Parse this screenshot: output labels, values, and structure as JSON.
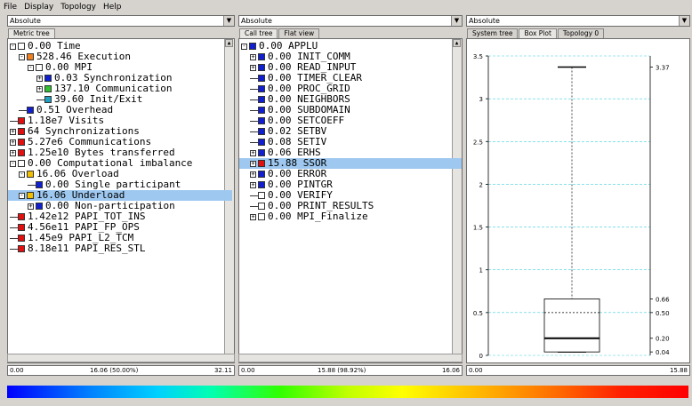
{
  "menu": [
    "File",
    "Display",
    "Topology",
    "Help"
  ],
  "combos": [
    "Absolute",
    "Absolute",
    "Absolute"
  ],
  "left_tabs": [
    "Metric tree"
  ],
  "mid_tabs": [
    "Call tree",
    "Flat view"
  ],
  "right_tabs": [
    "System tree",
    "Box Plot",
    "Topology 0"
  ],
  "metric_tree": [
    {
      "text": "0.00 Time",
      "color": "#ffffff",
      "level": 0,
      "exp": "-"
    },
    {
      "text": "528.46 Execution",
      "color": "#f08020",
      "level": 1,
      "exp": "-"
    },
    {
      "text": "0.00 MPI",
      "color": "#ffffff",
      "level": 2,
      "exp": "-"
    },
    {
      "text": "0.03 Synchronization",
      "color": "#1020d0",
      "level": 3,
      "exp": "+"
    },
    {
      "text": "137.10 Communication",
      "color": "#30c030",
      "level": 3,
      "exp": "+"
    },
    {
      "text": "39.60 Init/Exit",
      "color": "#20a0c0",
      "level": 3,
      "exp": ""
    },
    {
      "text": "0.51 Overhead",
      "color": "#1020d0",
      "level": 1,
      "exp": ""
    },
    {
      "text": "1.18e7 Visits",
      "color": "#e01010",
      "level": 0,
      "exp": ""
    },
    {
      "text": "64 Synchronizations",
      "color": "#e01010",
      "level": 0,
      "exp": "+"
    },
    {
      "text": "5.27e6 Communications",
      "color": "#e01010",
      "level": 0,
      "exp": "+"
    },
    {
      "text": "1.25e10 Bytes transferred",
      "color": "#e01010",
      "level": 0,
      "exp": "+"
    },
    {
      "text": "0.00 Computational imbalance",
      "color": "#ffffff",
      "level": 0,
      "exp": "-"
    },
    {
      "text": "16.06 Overload",
      "color": "#f0c000",
      "level": 1,
      "exp": "-"
    },
    {
      "text": "0.00 Single participant",
      "color": "#1020d0",
      "level": 2,
      "exp": ""
    },
    {
      "text": "16.06 Underload",
      "color": "#f0c000",
      "level": 1,
      "exp": "-",
      "selected": true
    },
    {
      "text": "0.00 Non-participation",
      "color": "#1020d0",
      "level": 2,
      "exp": "+"
    },
    {
      "text": "1.42e12 PAPI_TOT_INS",
      "color": "#e01010",
      "level": 0,
      "exp": ""
    },
    {
      "text": "4.56e11 PAPI_FP_OPS",
      "color": "#e01010",
      "level": 0,
      "exp": ""
    },
    {
      "text": "1.45e9 PAPI_L2_TCM",
      "color": "#e01010",
      "level": 0,
      "exp": ""
    },
    {
      "text": "8.18e11 PAPI_RES_STL",
      "color": "#e01010",
      "level": 0,
      "exp": ""
    }
  ],
  "call_tree": [
    {
      "text": "0.00 APPLU",
      "color": "#1020d0",
      "level": 0,
      "exp": "-"
    },
    {
      "text": "0.00 INIT_COMM",
      "color": "#1020d0",
      "level": 1,
      "exp": "+"
    },
    {
      "text": "0.00 READ_INPUT",
      "color": "#1020d0",
      "level": 1,
      "exp": "+"
    },
    {
      "text": "0.00 TIMER_CLEAR",
      "color": "#1020d0",
      "level": 1,
      "exp": ""
    },
    {
      "text": "0.00 PROC_GRID",
      "color": "#1020d0",
      "level": 1,
      "exp": ""
    },
    {
      "text": "0.00 NEIGHBORS",
      "color": "#1020d0",
      "level": 1,
      "exp": ""
    },
    {
      "text": "0.00 SUBDOMAIN",
      "color": "#1020d0",
      "level": 1,
      "exp": ""
    },
    {
      "text": "0.00 SETCOEFF",
      "color": "#1020d0",
      "level": 1,
      "exp": ""
    },
    {
      "text": "0.02 SETBV",
      "color": "#1020d0",
      "level": 1,
      "exp": ""
    },
    {
      "text": "0.08 SETIV",
      "color": "#1020d0",
      "level": 1,
      "exp": ""
    },
    {
      "text": "0.06 ERHS",
      "color": "#1020d0",
      "level": 1,
      "exp": "+"
    },
    {
      "text": "15.88 SSOR",
      "color": "#e01010",
      "level": 1,
      "exp": "+",
      "selected": true
    },
    {
      "text": "0.00 ERROR",
      "color": "#1020d0",
      "level": 1,
      "exp": "+"
    },
    {
      "text": "0.00 PINTGR",
      "color": "#1020d0",
      "level": 1,
      "exp": "+"
    },
    {
      "text": "0.00 VERIFY",
      "color": "#ffffff",
      "level": 1,
      "exp": ""
    },
    {
      "text": "0.00 PRINT_RESULTS",
      "color": "#ffffff",
      "level": 1,
      "exp": ""
    },
    {
      "text": "0.00 MPI_Finalize",
      "color": "#ffffff",
      "level": 1,
      "exp": "+"
    }
  ],
  "value_bars": [
    {
      "min": "0.00",
      "mid": "16.06 (50.00%)",
      "max": "32.11"
    },
    {
      "min": "0.00",
      "mid": "15.88 (98.92%)",
      "max": "16.06"
    },
    {
      "min": "0.00",
      "max": "15.88"
    }
  ],
  "chart_data": {
    "type": "box",
    "ylim": [
      0,
      3.5
    ],
    "yticks": [
      "0",
      "0.5",
      "1",
      "1.5",
      "2",
      "2.5",
      "3",
      "3.5"
    ],
    "min": 0.04,
    "q1": 0.04,
    "median": 0.2,
    "mean": 0.5,
    "q3": 0.66,
    "max": 3.37,
    "right_labels": [
      "3.37",
      "0.66",
      "0.50",
      "0.20",
      "0.04"
    ],
    "grid": true
  }
}
